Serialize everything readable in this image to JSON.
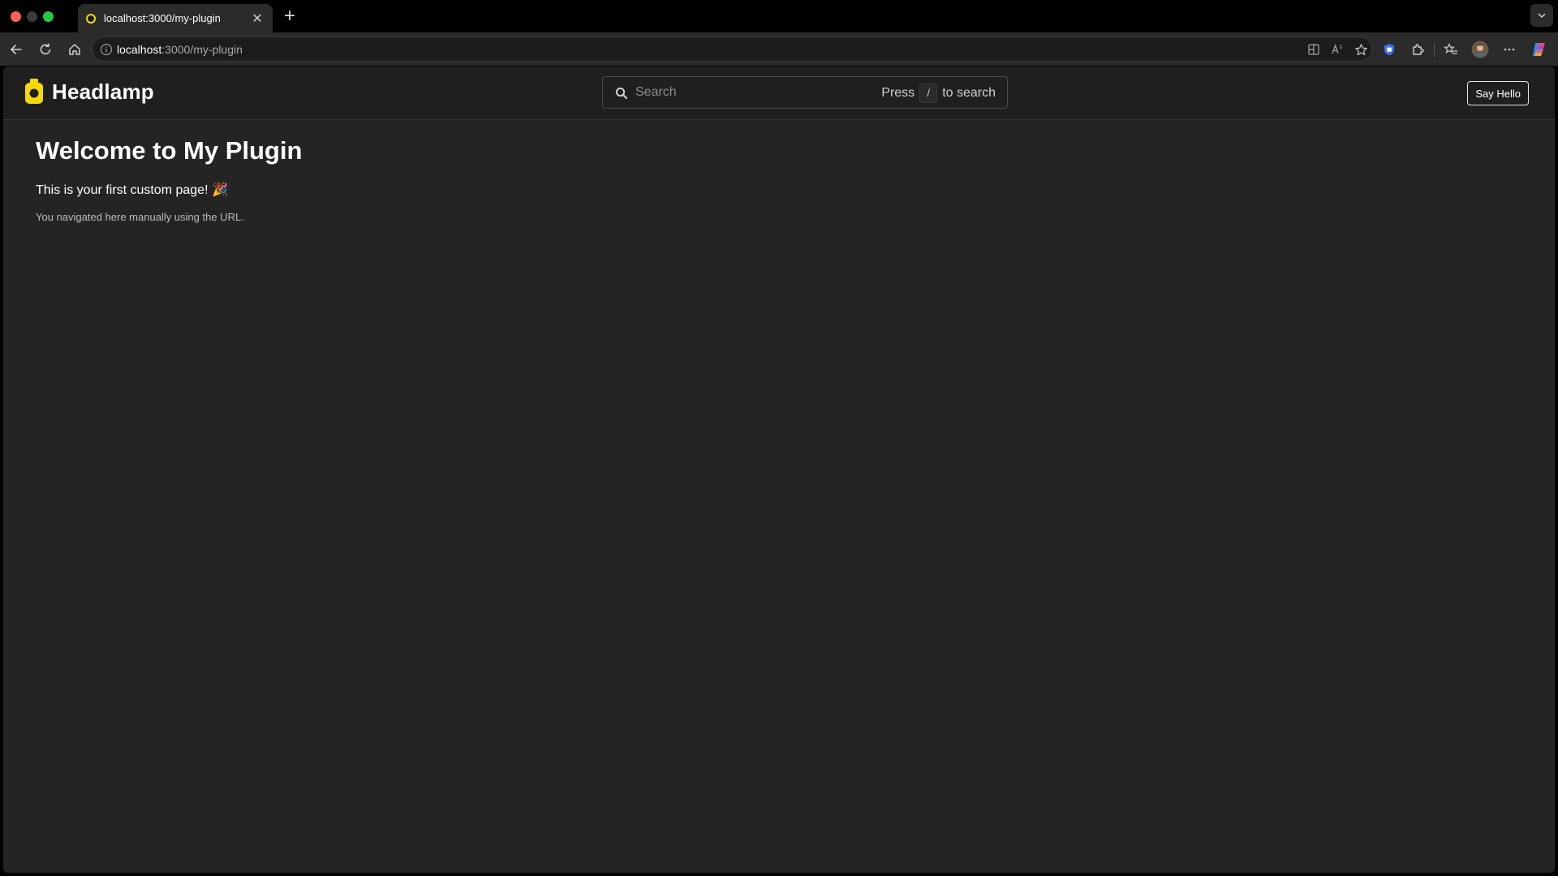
{
  "browser": {
    "tab": {
      "title": "localhost:3000/my-plugin",
      "close_glyph": "✕"
    },
    "new_tab_glyph": "+",
    "address": {
      "host": "localhost",
      "path": ":3000/my-plugin"
    }
  },
  "app": {
    "logo_text": "Headlamp",
    "search": {
      "placeholder": "Search",
      "hint_prefix": "Press",
      "hint_key": "/",
      "hint_suffix": "to search"
    },
    "say_hello_label": "Say Hello"
  },
  "page": {
    "title": "Welcome to My Plugin",
    "subtitle": "This is your first custom page!",
    "emoji": "🎉",
    "note": "You navigated here manually using the URL."
  },
  "colors": {
    "brand": "#f5d90a",
    "page_bg": "#242424",
    "appbar_bg": "#1f1f1f"
  },
  "icons": [
    "back-icon",
    "reload-icon",
    "home-icon",
    "info-icon",
    "split-screen-icon",
    "read-aloud-icon",
    "favorite-star-icon",
    "shield-extension-icon",
    "extensions-icon",
    "favorites-icon",
    "profile-avatar-icon",
    "more-icon",
    "copilot-icon",
    "search-icon",
    "headlamp-logo-icon"
  ]
}
